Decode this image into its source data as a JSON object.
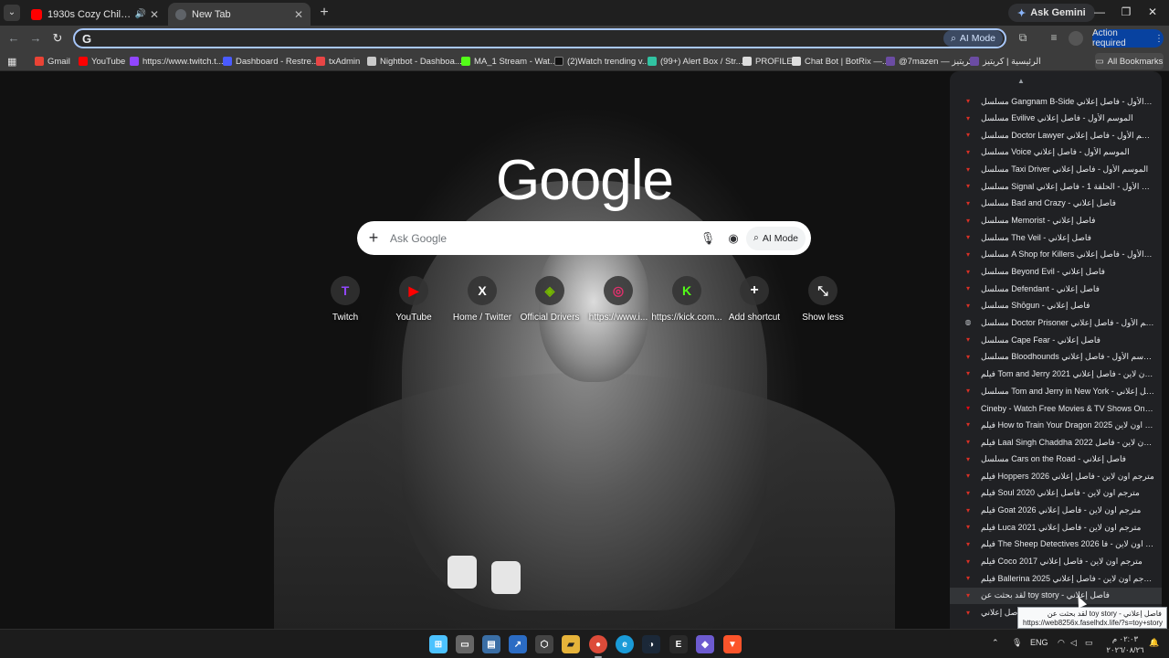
{
  "browser": {
    "tabs": [
      {
        "title": "1930s Cozy Chill Jazz Mood",
        "favicon": "youtube-icon",
        "color": "#ff0000"
      },
      {
        "title": "New Tab",
        "favicon": "chrome-icon",
        "color": "#9aa0a6"
      }
    ],
    "ask_gemini": "Ask Gemini",
    "omnibox": {
      "value": "",
      "ai_mode": "AI Mode"
    },
    "action_required": "Action required"
  },
  "bookmarks": [
    {
      "label": "Gmail",
      "color": "#ea4335"
    },
    {
      "label": "YouTube",
      "color": "#ff0000"
    },
    {
      "label": "https://www.twitch.t...",
      "color": "#9146ff"
    },
    {
      "label": "Dashboard - Restre...",
      "color": "#4a5bff"
    },
    {
      "label": "txAdmin",
      "color": "#e84545"
    },
    {
      "label": "Nightbot - Dashboa...",
      "color": "#c9c9c9"
    },
    {
      "label": "MA_1 Stream - Wat...",
      "color": "#53fc18"
    },
    {
      "label": "(2)Watch trending v...",
      "color": "#111111"
    },
    {
      "label": "(99+) Alert Box / Str...",
      "color": "#31c3a2"
    },
    {
      "label": "PROFILE",
      "color": "#dddddd"
    },
    {
      "label": "Chat Bot | BotRix —...",
      "color": "#dddddd"
    },
    {
      "label": "@7mazen — كريتيز",
      "color": "#6b4ca3"
    },
    {
      "label": "الرئيسية | كريتيز",
      "color": "#6b4ca3"
    }
  ],
  "all_bookmarks": "All Bookmarks",
  "ntp": {
    "logo": "Google",
    "search_placeholder": "Ask Google",
    "ai_mode": "AI Mode",
    "shortcuts": [
      {
        "label": "Twitch",
        "glyph": "T",
        "color": "#9146ff"
      },
      {
        "label": "YouTube",
        "glyph": "▶",
        "color": "#ff0000"
      },
      {
        "label": "Home / Twitter",
        "glyph": "X",
        "color": "#ffffff"
      },
      {
        "label": "Official Drivers",
        "glyph": "◈",
        "color": "#76b900"
      },
      {
        "label": "https://www.i...",
        "glyph": "◎",
        "color": "#e1306c"
      },
      {
        "label": "https://kick.com...",
        "glyph": "K",
        "color": "#53fc18"
      },
      {
        "label": "Add shortcut",
        "glyph": "+",
        "color": "#ffffff"
      },
      {
        "label": "Show less",
        "glyph": "⤡",
        "color": "#ffffff"
      }
    ]
  },
  "history": [
    "مسلسل Gangnam B-Side الموسم الأول - فاصل إعلاني",
    "مسلسل Evilive الموسم الأول - فاصل إعلاني",
    "مسلسل Doctor Lawyer الموسم الأول - فاصل إعلاني",
    "مسلسل Voice الموسم الأول - فاصل إعلاني",
    "مسلسل Taxi Driver الموسم الأول - فاصل إعلاني",
    "مسلسل Signal الموسم الأول - الحلقة 1 - فاصل إعلاني",
    "مسلسل Bad and Crazy - فاصل إعلاني",
    "مسلسل Memorist - فاصل إعلاني",
    "مسلسل The Veil - فاصل إعلاني",
    "مسلسل A Shop for Killers الموسم الأول - فاصل إعلاني",
    "مسلسل Beyond Evil - فاصل إعلاني",
    "مسلسل Defendant - فاصل إعلاني",
    "مسلسل Shōgun - فاصل إعلاني",
    "مسلسل Doctor Prisoner الموسم الأول - فاصل إعلاني",
    "مسلسل Cape Fear - فاصل إعلاني",
    "مسلسل Bloodhounds الموسم الأول - فاصل إعلاني",
    "فيلم Tom and Jerry 2021 مترجم اون لاين - فاصل إعلاني",
    "مسلسل Tom and Jerry in New York - فاصل إعلاني",
    "Cineby - Watch Free Movies & TV Shows Online",
    "فيلم How to Train Your Dragon 2025 مترجم اون لاين -...",
    "فيلم Laal Singh Chaddha 2022 مترجم اون لاين - فاصل...",
    "مسلسل Cars on the Road - فاصل إعلاني",
    "فيلم Hoppers 2026 مترجم اون لاين - فاصل إعلاني",
    "فيلم Soul 2020 مترجم اون لاين - فاصل إعلاني",
    "فيلم Goat 2026 مترجم اون لاين - فاصل إعلاني",
    "فيلم Luca 2021 مترجم اون لاين - فاصل إعلاني",
    "فيلم The Sheep Detectives 2026 مترجم اون لاين - فا...",
    "فيلم Coco 2017 مترجم اون لاين - فاصل إعلاني",
    "فيلم Ballerina 2025 مترجم اون لاين - فاصل إعلاني",
    "لقد بحثت عن toy story - فاصل إعلاني",
    "فاصل إعلاني"
  ],
  "tooltip": {
    "line1": "لقد بحثت عن toy story - فاصل إعلاني",
    "line2": "https://web8256x.faselhdx.life/?s=toy+story"
  },
  "taskbar": {
    "lang": "ENG",
    "time": "٠٢:٠٣ م",
    "date": "٢٠٢٦/٠٨/٢٦"
  }
}
